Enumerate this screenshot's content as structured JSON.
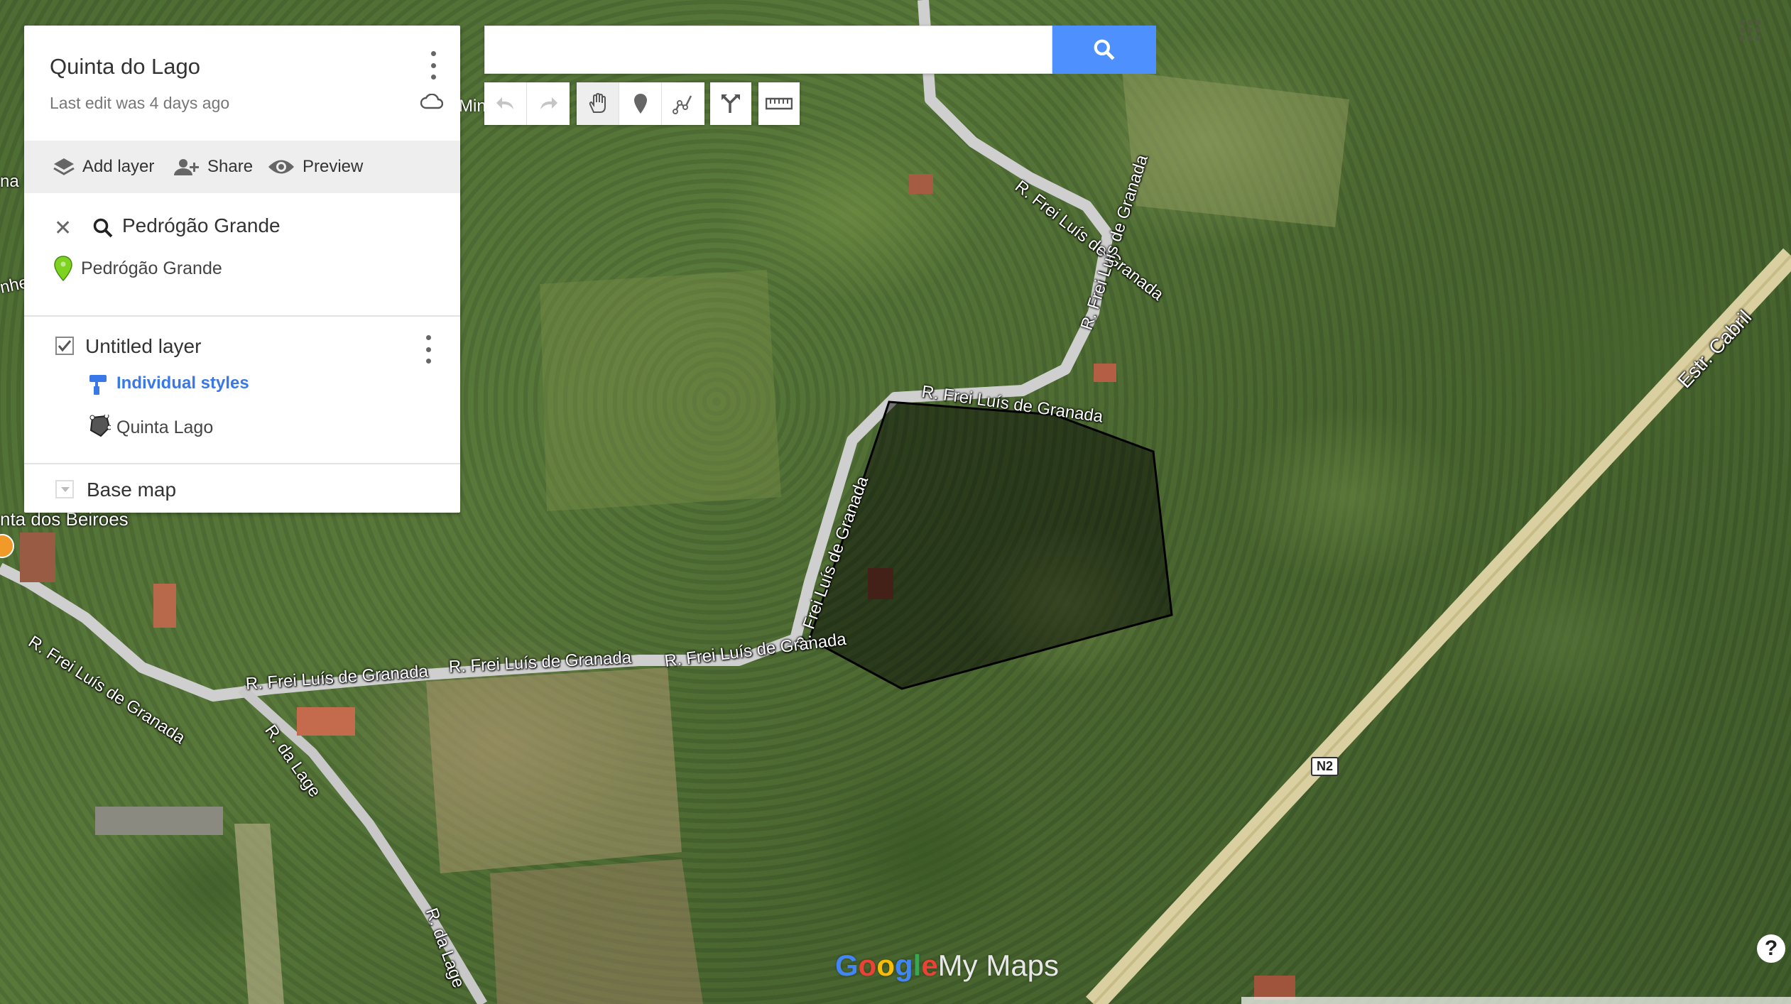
{
  "panel": {
    "map_title": "Quinta do Lago",
    "last_edit": "Last edit was 4 days ago",
    "toolbar": {
      "add_layer": "Add layer",
      "share": "Share",
      "preview": "Preview"
    },
    "search": {
      "query": "Pedrógão Grande",
      "result": "Pedrógão Grande"
    },
    "layer": {
      "name": "Untitled layer",
      "checked": true,
      "styles_link": "Individual styles",
      "feature": "Quinta Lago"
    },
    "base_map": "Base map"
  },
  "searchbar": {
    "value": "",
    "placeholder": ""
  },
  "tools": [
    "undo-icon",
    "redo-icon",
    "hand-icon",
    "marker-icon",
    "draw-line-icon",
    "directions-icon",
    "ruler-icon"
  ],
  "map_labels": {
    "road_1": "R. Frei Luís de Granada",
    "road_2": "R. Frei Luís de Granada",
    "road_3": "R. Frei Luís de Granada",
    "road_4": "R. Frei Luís de Granada",
    "road_5": "R. Frei Luís de Granada",
    "road_6": "R. Frei Luís de Granada",
    "road_7": "R. Frei Luís de Granada",
    "lage_1": "R. da Lage",
    "lage_2": "R. da Lage",
    "estr": "Estr. Cabril",
    "n2": "N2",
    "place": "nta dos Beiroes",
    "partial_1": "Min",
    "partial_2": "na",
    "partial_3": "nhe"
  },
  "brand": {
    "g1": "G",
    "g2": "o",
    "g3": "o",
    "g4": "g",
    "g5": "l",
    "g6": "e",
    "suffix": "My Maps"
  },
  "help": "?",
  "colors": {
    "accent": "#4d90fe",
    "link": "#3b78e7",
    "pin_green": "#7ed321"
  }
}
